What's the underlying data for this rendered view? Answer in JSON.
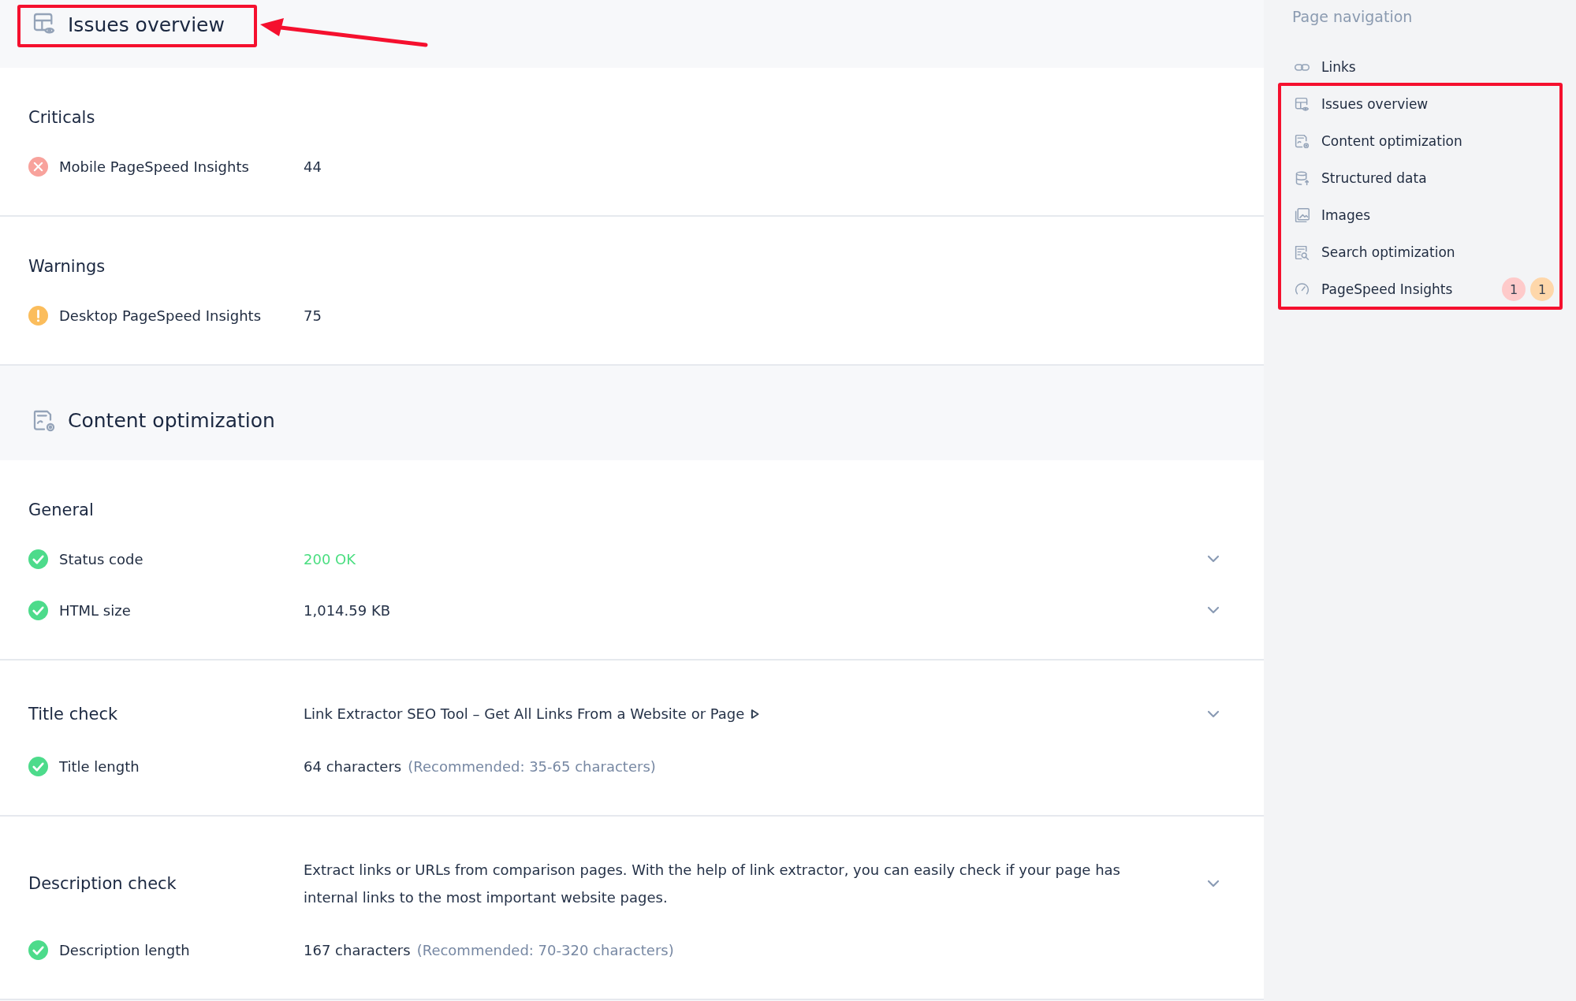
{
  "main": {
    "sections": [
      {
        "title": "Issues overview",
        "groups": [
          {
            "title": "Criticals",
            "rows": [
              {
                "kind": "error",
                "label": "Mobile PageSpeed Insights",
                "value": "44",
                "highlighted": false,
                "expandable": false
              }
            ]
          },
          {
            "title": "Warnings",
            "rows": [
              {
                "kind": "warning",
                "label": "Desktop PageSpeed Insights",
                "value": "75",
                "highlighted": false,
                "expandable": false
              }
            ]
          }
        ]
      },
      {
        "title": "Content optimization",
        "groups": [
          {
            "title": "General",
            "rows": [
              {
                "kind": "ok",
                "label": "Status code",
                "value": "200 OK",
                "highlighted": true,
                "expandable": true
              },
              {
                "kind": "ok",
                "label": "HTML size",
                "value": "1,014.59 KB",
                "highlighted": false,
                "expandable": true
              }
            ]
          },
          {
            "title": "Title check",
            "value": "Link Extractor SEO Tool – Get All Links From a Website or Page",
            "link": true,
            "expandable": true,
            "rows": [
              {
                "kind": "ok",
                "label": "Title length",
                "value": "64 characters",
                "note": "(Recommended: 35-65 characters)",
                "highlighted": false,
                "expandable": false
              }
            ]
          },
          {
            "title": "Description check",
            "value": "Extract links or URLs from comparison pages. With the help of link extractor, you can easily check if your page has internal links to the most important website pages.",
            "link": false,
            "expandable": true,
            "rows": [
              {
                "kind": "ok",
                "label": "Description length",
                "value": "167 characters",
                "note": "(Recommended: 70-320 characters)",
                "highlighted": false,
                "expandable": false
              }
            ]
          }
        ]
      }
    ]
  },
  "navigation": {
    "title": "Page navigation",
    "items": [
      {
        "label": "Links"
      },
      {
        "label": "Issues overview"
      },
      {
        "label": "Content optimization"
      },
      {
        "label": "Structured data"
      },
      {
        "label": "Images"
      },
      {
        "label": "Search optimization"
      },
      {
        "label": "PageSpeed Insights",
        "badges": [
          {
            "count": "1",
            "color": "#fecaca"
          },
          {
            "count": "1",
            "color": "#fed7aa"
          }
        ]
      }
    ]
  }
}
